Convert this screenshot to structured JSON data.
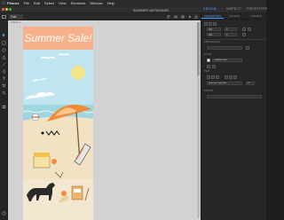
{
  "menubar": {
    "items": [
      "Pharos",
      "File",
      "Edit",
      "Select",
      "View",
      "Elements",
      "Window",
      "Help"
    ]
  },
  "window": {
    "title": "SUMMER ARTBOARD",
    "tabs": [
      "DESIGN",
      "INSPECT",
      "PROTOTYPE"
    ]
  },
  "toolbar": {
    "document_tab": "Sale"
  },
  "stage": {
    "artboard_label": "Frame 1"
  },
  "artboard": {
    "headline": "Summer Sale!",
    "colors": {
      "banner": "#f6b08a",
      "sky": "#bfe6ee",
      "sun": "#f5e48a",
      "sea": "#9fd7df",
      "sand": "#f0e2c2",
      "umbrella_orange": "#f08a3a",
      "umbrella_light": "#f7c689",
      "dog": "#2a2a2a"
    }
  },
  "panel": {
    "tabs": [
      "PROPERTIES",
      "LAYERS",
      "ASSETS"
    ],
    "active_tab": "PROPERTIES",
    "sections": {
      "appearance": "APPEARANCE",
      "style": "STYLE",
      "text": "TEXT",
      "export": "EXPORT"
    },
    "fields": {
      "width": "100",
      "height": "240",
      "x": "0",
      "y": "0",
      "fill": "#F6B08A  100%",
      "font": "Grotesque Light Italic",
      "font_size": "18"
    }
  }
}
